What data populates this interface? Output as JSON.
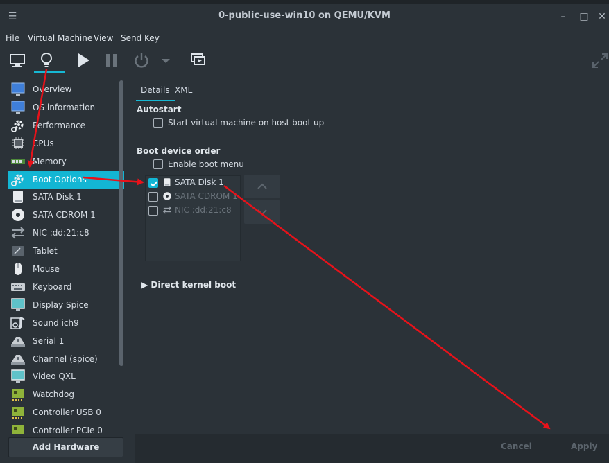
{
  "window": {
    "title": "0-public-use-win10 on QEMU/KVM"
  },
  "menubar": [
    "File",
    "Virtual Machine",
    "View",
    "Send Key"
  ],
  "toolbar": {
    "tools": [
      "console-icon",
      "details-icon",
      "run-icon",
      "pause-icon",
      "shutdown-icon",
      "shutdown-menu-icon",
      "snapshots-icon"
    ],
    "active": "details-icon"
  },
  "sidebar": {
    "items": [
      {
        "label": "Overview",
        "icon": "monitor-icon"
      },
      {
        "label": "OS information",
        "icon": "monitor-icon"
      },
      {
        "label": "Performance",
        "icon": "gear-icon"
      },
      {
        "label": "CPUs",
        "icon": "cpu-icon"
      },
      {
        "label": "Memory",
        "icon": "memory-icon"
      },
      {
        "label": "Boot Options",
        "icon": "gear-icon"
      },
      {
        "label": "SATA Disk 1",
        "icon": "disk-icon"
      },
      {
        "label": "SATA CDROM 1",
        "icon": "cdrom-icon"
      },
      {
        "label": "NIC :dd:21:c8",
        "icon": "network-icon"
      },
      {
        "label": "Tablet",
        "icon": "tablet-icon"
      },
      {
        "label": "Mouse",
        "icon": "mouse-icon"
      },
      {
        "label": "Keyboard",
        "icon": "keyboard-icon"
      },
      {
        "label": "Display Spice",
        "icon": "display-icon"
      },
      {
        "label": "Sound ich9",
        "icon": "sound-icon"
      },
      {
        "label": "Serial 1",
        "icon": "serial-icon"
      },
      {
        "label": "Channel (spice)",
        "icon": "serial-icon"
      },
      {
        "label": "Video QXL",
        "icon": "display-icon"
      },
      {
        "label": "Watchdog",
        "icon": "pci-card-icon"
      },
      {
        "label": "Controller USB 0",
        "icon": "pci-card-icon"
      },
      {
        "label": "Controller PCIe 0",
        "icon": "pci-card-icon"
      }
    ],
    "selected_index": 5,
    "add_hardware_label": "Add Hardware"
  },
  "tabs": [
    {
      "label": "Details",
      "active": true
    },
    {
      "label": "XML",
      "active": false
    }
  ],
  "autostart": {
    "title": "Autostart",
    "checkbox_label": "Start virtual machine on host boot up",
    "checked": false
  },
  "boot": {
    "title": "Boot device order",
    "enable_menu_label": "Enable boot menu",
    "enable_menu_checked": false,
    "devices": [
      {
        "label": "SATA Disk 1",
        "checked": true,
        "enabled": true,
        "icon": "disk-icon"
      },
      {
        "label": "SATA CDROM 1",
        "checked": false,
        "enabled": false,
        "icon": "cdrom-icon"
      },
      {
        "label": "NIC :dd:21:c8",
        "checked": false,
        "enabled": false,
        "icon": "network-icon"
      }
    ]
  },
  "direct_kernel_boot_label": "Direct kernel boot",
  "footer": {
    "cancel_label": "Cancel",
    "apply_label": "Apply"
  },
  "colors": {
    "accent": "#13b6d4",
    "background": "#2b3238",
    "annotation_arrow": "#e8121a"
  }
}
